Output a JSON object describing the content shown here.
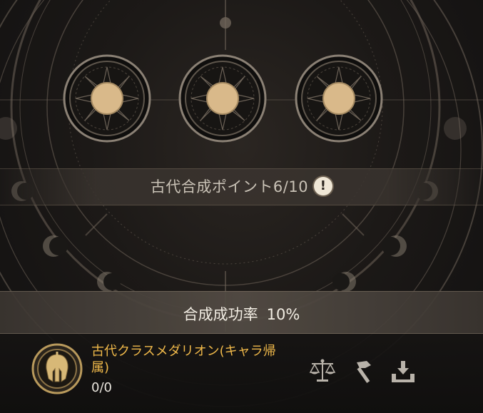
{
  "synthesis": {
    "points_label": "古代合成ポイント6/10",
    "success_rate_label": "合成成功率",
    "success_rate_value": "10%"
  },
  "slots": [
    {
      "icon": "medal-slot-empty"
    },
    {
      "icon": "medal-slot-empty"
    },
    {
      "icon": "medal-slot-empty"
    }
  ],
  "item": {
    "icon": "helmet-medallion-icon",
    "name": "古代クラスメダリオン(キャラ帰属)",
    "count": "0/0"
  },
  "actions": [
    {
      "icon": "scale-icon"
    },
    {
      "icon": "hammer-icon"
    },
    {
      "icon": "receive-icon"
    }
  ],
  "colors": {
    "item_name": "#f0b94a",
    "slot_core": "#d9b98a",
    "info_badge": "#efe7d6"
  }
}
